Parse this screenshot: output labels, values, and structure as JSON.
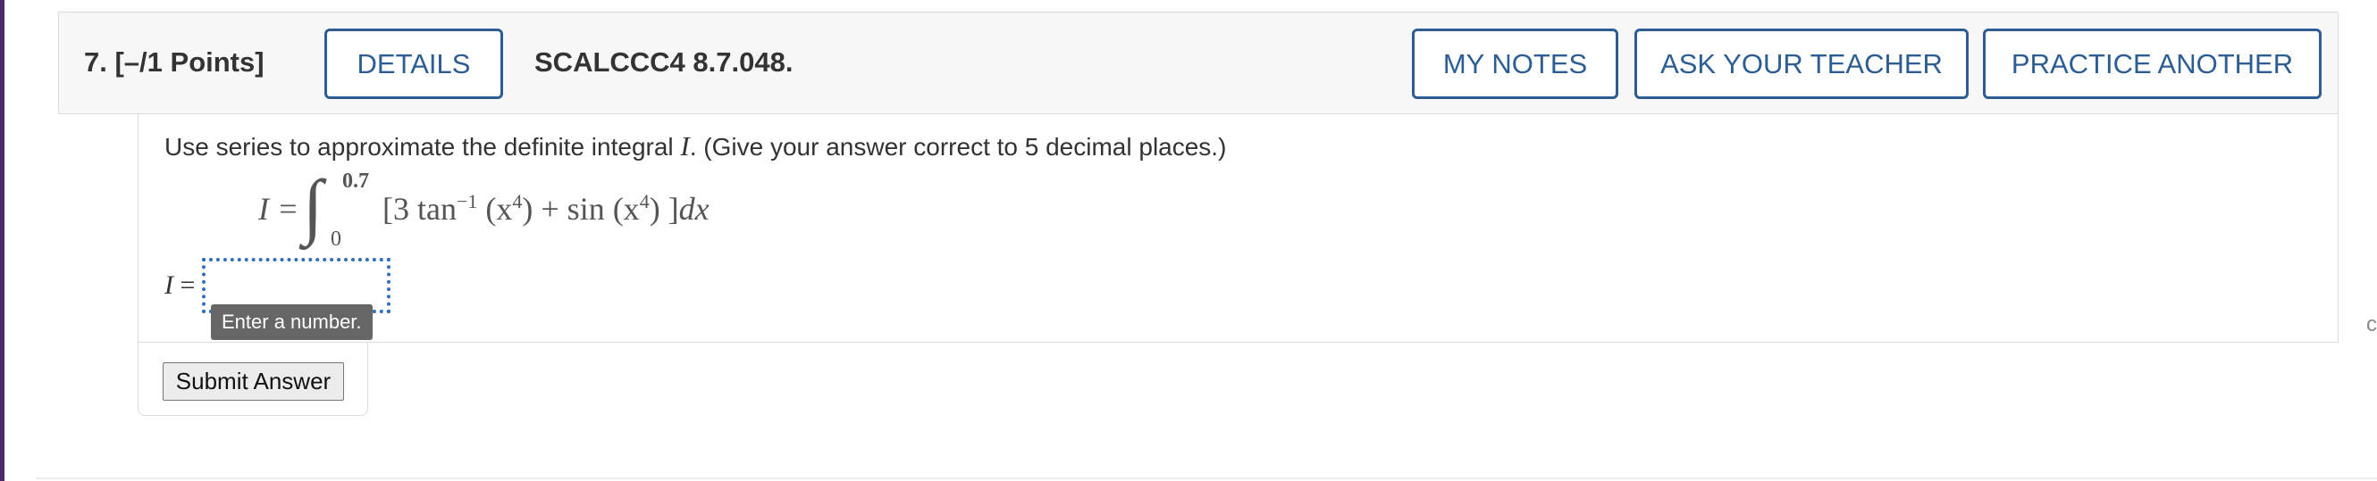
{
  "question": {
    "number": "7.",
    "points": "[–/1 Points]",
    "details_label": "DETAILS",
    "reference": "SCALCCC4 8.7.048.",
    "my_notes_label": "MY NOTES",
    "ask_teacher_label": "ASK YOUR TEACHER",
    "practice_label": "PRACTICE ANOTHER"
  },
  "prompt": {
    "before": "Use series to approximate the definite integral ",
    "variable": "I",
    "after": ". (Give your answer correct to 5 decimal places.)"
  },
  "formula": {
    "lhs": "I =",
    "integral_sign": "∫",
    "upper_limit": "0.7",
    "lower_limit": "0",
    "open_bracket": "[3 tan",
    "inv_exponent": "−1",
    "arg1_open": " (x",
    "power1": "4",
    "arg1_close": ") + sin (x",
    "power2": "4",
    "arg2_close": ") ]",
    "differential": "dx"
  },
  "answer": {
    "label_var": "I",
    "label_eq": " =",
    "value": "",
    "tooltip": "Enter a number."
  },
  "submit_label": "Submit Answer",
  "colors": {
    "accent_blue": "#2c5d93",
    "input_focus_dots": "#2e6fbe",
    "tooltip_bg": "#666666",
    "left_accent": "#4a2a6b"
  }
}
